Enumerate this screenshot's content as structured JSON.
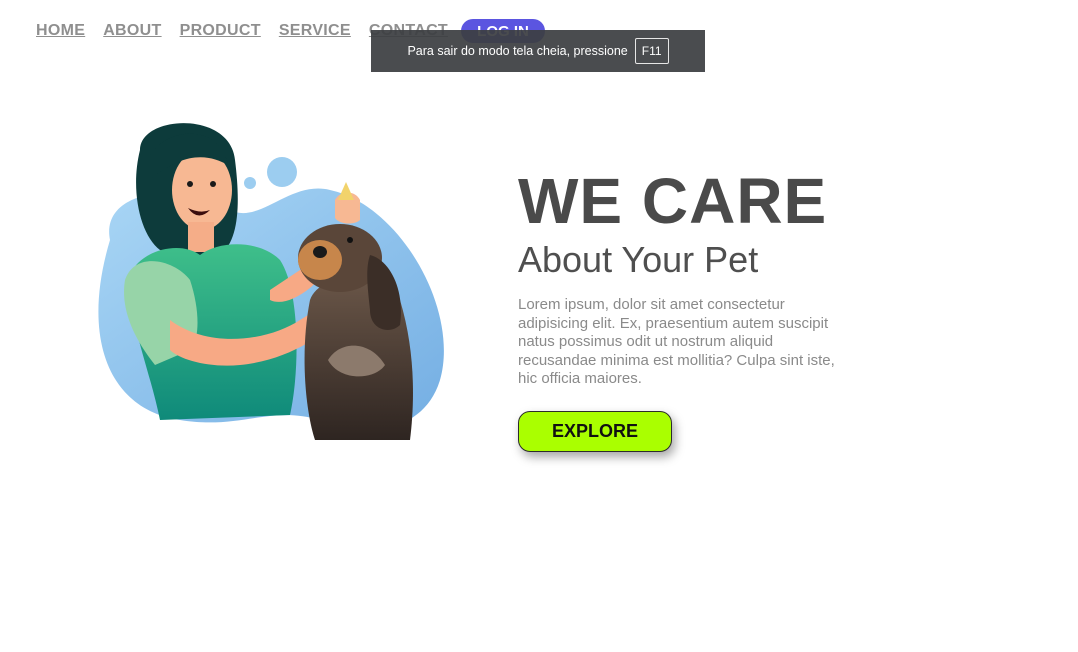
{
  "nav": {
    "items": [
      {
        "label": "HOME"
      },
      {
        "label": "ABOUT"
      },
      {
        "label": "PRODUCT"
      },
      {
        "label": "SERVICE"
      },
      {
        "label": "CONTACT"
      }
    ],
    "login_label": "LOG IN"
  },
  "fullscreen_notice": {
    "text": "Para sair do modo tela cheia, pressione",
    "key": "F11"
  },
  "hero": {
    "headline": "WE CARE",
    "subhead": "About Your Pet",
    "body": "Lorem ipsum, dolor sit amet consectetur adipisicing elit. Ex, praesentium autem suscipit natus possimus odit ut nostrum aliquid recusandae minima est mollitia? Culpa sint iste, hic officia maiores.",
    "button_label": "EXPLORE"
  },
  "colors": {
    "accent_button": "#aaff00",
    "login_button": "#5b55e0",
    "headline": "#4a4a4a",
    "blob": "#8cc4ee"
  }
}
